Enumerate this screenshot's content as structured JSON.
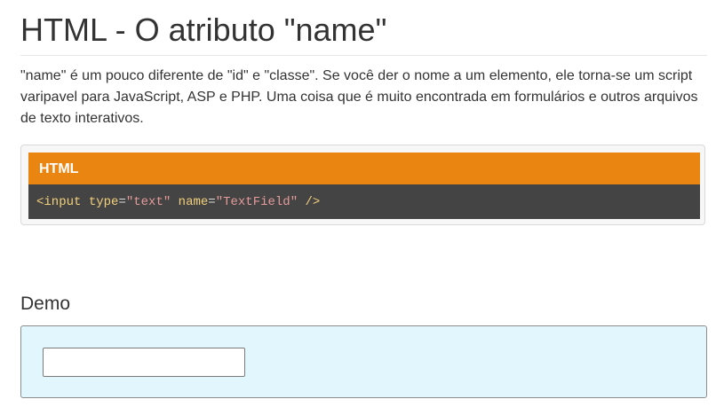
{
  "page": {
    "title": "HTML - O atributo \"name\"",
    "intro": "\"name\" é um pouco diferente de \"id\" e \"classe\". Se você der o nome a um elemento, ele torna-se um script varipavel para JavaScript, ASP e PHP. Uma coisa que é muito encontrada em formulários e outros arquivos de texto interativos."
  },
  "code_example": {
    "language_label": "HTML",
    "tokens": {
      "open": "<input",
      "attr1": "type",
      "eq1": "=",
      "val1": "\"text\"",
      "attr2": "name",
      "eq2": "=",
      "val2": "\"TextField\"",
      "close": "/>"
    },
    "colors": {
      "header_bg": "#ea8511",
      "body_bg": "#444444",
      "tag": "#f3d07b",
      "string": "#e49a9a"
    }
  },
  "demo": {
    "heading": "Demo",
    "input_value": "",
    "background": "#e1f6fd"
  }
}
